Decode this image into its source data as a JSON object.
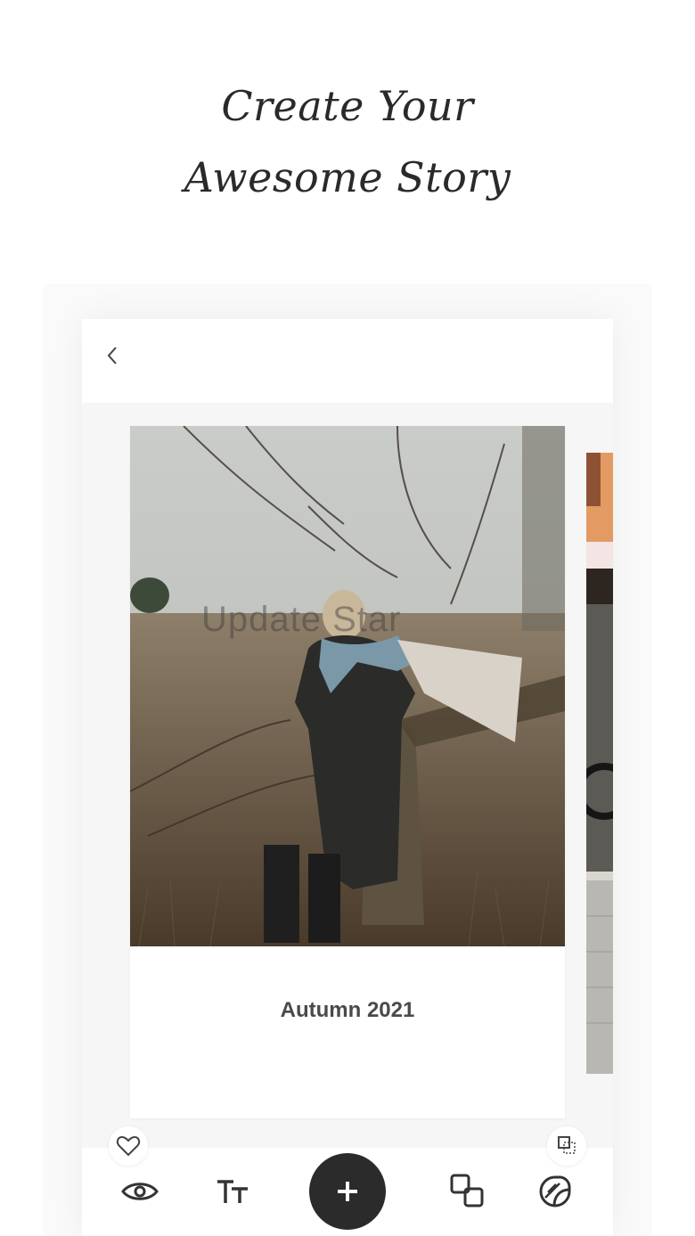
{
  "headline": {
    "line1": "Create Your",
    "line2": "Awesome Story"
  },
  "editor": {
    "back_icon": "chevron-left-icon",
    "card": {
      "caption": "Autumn 2021",
      "watermark": "Update Star"
    },
    "toolbar": {
      "items": [
        {
          "icon": "eye-icon"
        },
        {
          "icon": "text-size-icon"
        },
        {
          "icon": "plus-icon"
        },
        {
          "icon": "layers-icon"
        },
        {
          "icon": "sticker-icon"
        }
      ],
      "mini_left_icon": "heart-icon",
      "mini_right_icon": "resize-icon"
    },
    "colors": {
      "accent": "#2b2b2b",
      "caption": "#4a4a4a"
    }
  }
}
